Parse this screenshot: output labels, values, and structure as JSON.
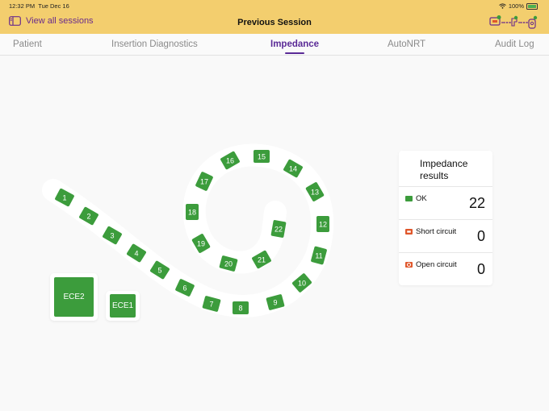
{
  "status_bar": {
    "time": "12:32 PM",
    "date": "Tue Dec 16",
    "battery": "100%"
  },
  "header": {
    "back_label": "View all sessions",
    "title": "Previous Session"
  },
  "tabs": [
    {
      "label": "Patient",
      "active": false
    },
    {
      "label": "Insertion Diagnostics",
      "active": false
    },
    {
      "label": "Impedance",
      "active": true
    },
    {
      "label": "AutoNRT",
      "active": false
    },
    {
      "label": "Audit Log",
      "active": false
    }
  ],
  "electrodes": [
    {
      "label": "1",
      "status": "ok"
    },
    {
      "label": "2",
      "status": "ok"
    },
    {
      "label": "3",
      "status": "ok"
    },
    {
      "label": "4",
      "status": "ok"
    },
    {
      "label": "5",
      "status": "ok"
    },
    {
      "label": "6",
      "status": "ok"
    },
    {
      "label": "7",
      "status": "ok"
    },
    {
      "label": "8",
      "status": "ok"
    },
    {
      "label": "9",
      "status": "ok"
    },
    {
      "label": "10",
      "status": "ok"
    },
    {
      "label": "11",
      "status": "ok"
    },
    {
      "label": "12",
      "status": "ok"
    },
    {
      "label": "13",
      "status": "ok"
    },
    {
      "label": "14",
      "status": "ok"
    },
    {
      "label": "15",
      "status": "ok"
    },
    {
      "label": "16",
      "status": "ok"
    },
    {
      "label": "17",
      "status": "ok"
    },
    {
      "label": "18",
      "status": "ok"
    },
    {
      "label": "19",
      "status": "ok"
    },
    {
      "label": "20",
      "status": "ok"
    },
    {
      "label": "21",
      "status": "ok"
    },
    {
      "label": "22",
      "status": "ok"
    }
  ],
  "ece": [
    {
      "label": "ECE2",
      "status": "ok"
    },
    {
      "label": "ECE1",
      "status": "ok"
    }
  ],
  "results": {
    "title": "Impedance results",
    "rows": [
      {
        "label": "OK",
        "value": "22",
        "icon": "ok-square-icon"
      },
      {
        "label": "Short circuit",
        "value": "0",
        "icon": "short-circuit-icon"
      },
      {
        "label": "Open circuit",
        "value": "0",
        "icon": "open-circuit-icon"
      }
    ]
  },
  "colors": {
    "header_bg": "#f3ce6e",
    "accent": "#5a2a96",
    "electrode_ok": "#3c9c3c",
    "short_circuit": "#e0572b",
    "open_circuit": "#e0572b"
  }
}
